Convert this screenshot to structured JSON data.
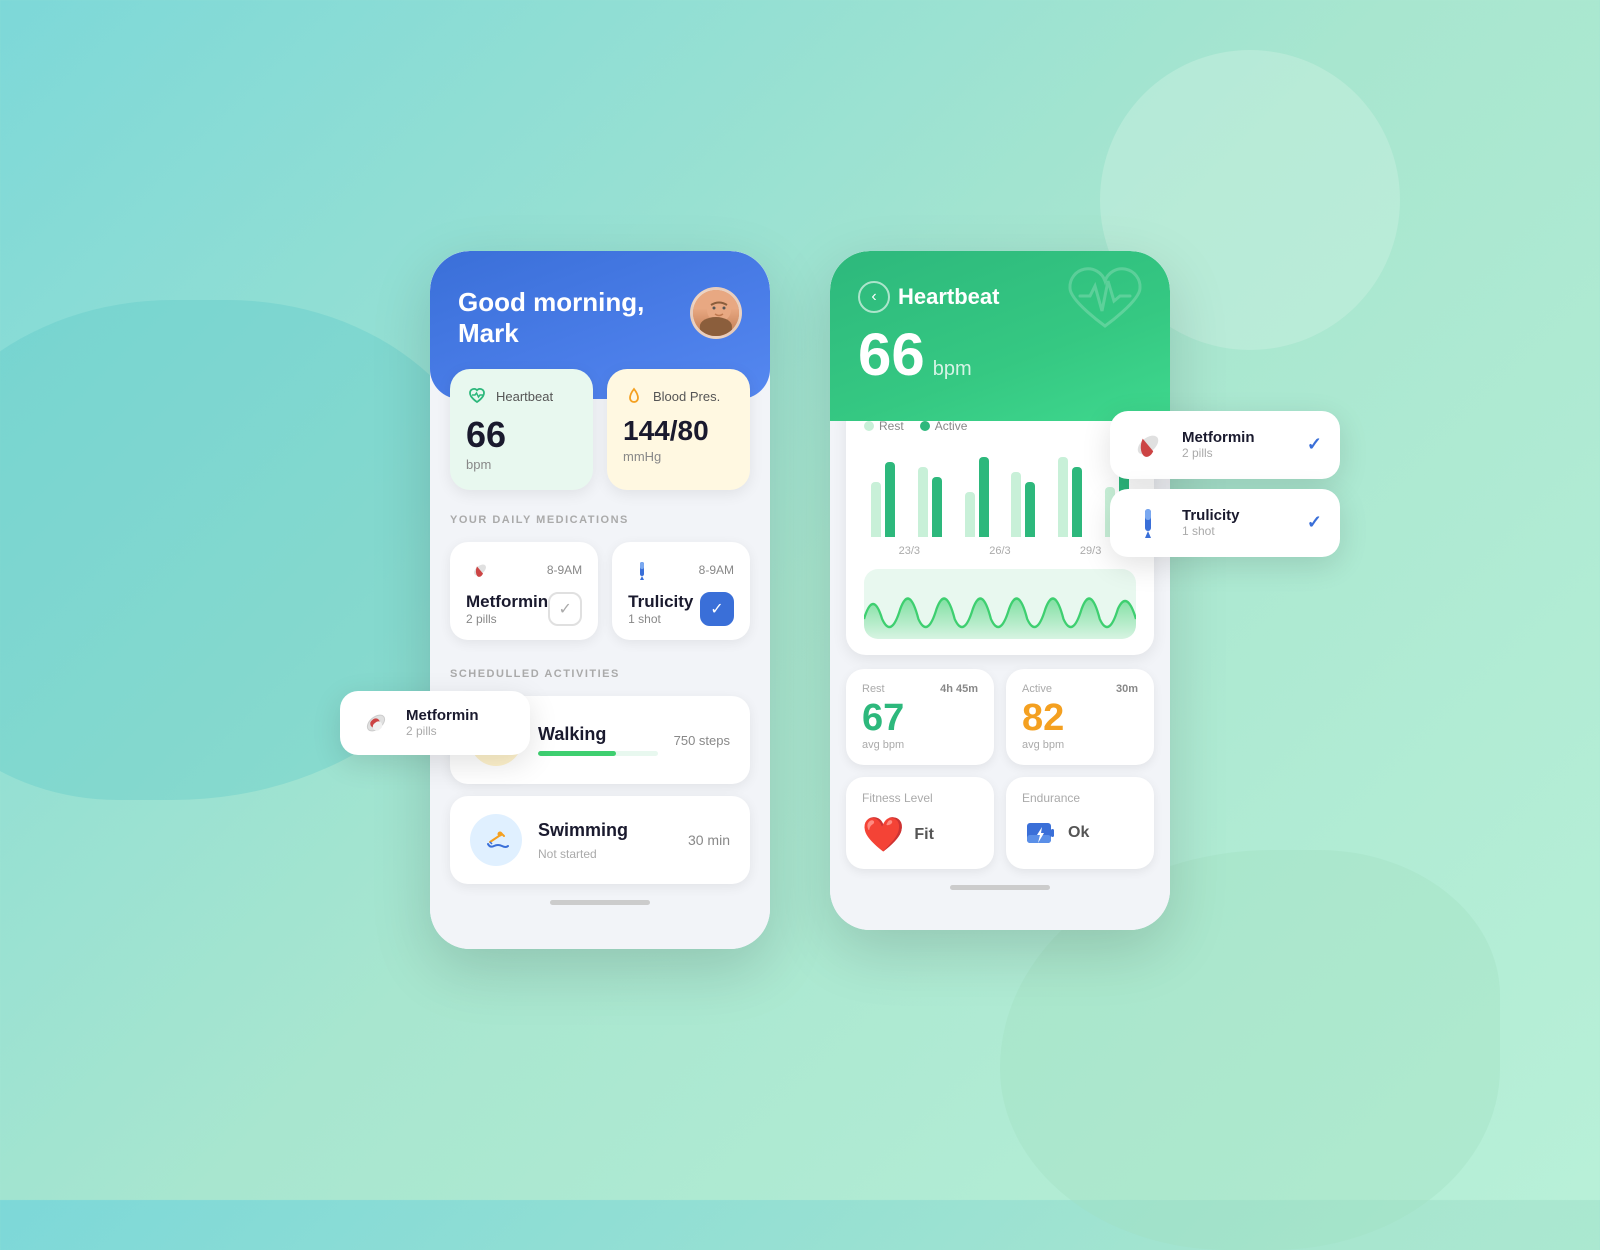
{
  "background": {
    "color1": "#7dd8d8",
    "color2": "#a8e6cf"
  },
  "leftPhone": {
    "greeting": "Good morning,\nMark",
    "greeting_line1": "Good morning,",
    "greeting_line2": "Mark",
    "metrics": [
      {
        "id": "heartbeat",
        "label": "Heartbeat",
        "value": "66",
        "unit": "bpm",
        "icon": "heart-icon",
        "cardType": "green"
      },
      {
        "id": "blood-pressure",
        "label": "Blood Pres.",
        "value": "144/80",
        "unit": "mmHg",
        "icon": "drop-icon",
        "cardType": "yellow"
      }
    ],
    "sectionMedications": "YOUR DAILY MEDICATIONS",
    "medications": [
      {
        "id": "metformin",
        "name": "Metformin",
        "dose": "2 pills",
        "time": "8-9AM",
        "checked": false,
        "icon": "pill-icon"
      },
      {
        "id": "trulicity",
        "name": "Trulicity",
        "dose": "1 shot",
        "time": "8-9AM",
        "checked": true,
        "icon": "syringe-icon"
      }
    ],
    "sectionActivities": "SCHEDULLED ACTIVITIES",
    "activities": [
      {
        "id": "walking",
        "name": "Walking",
        "steps": "750 steps",
        "progress": 65,
        "icon": "walking-icon",
        "iconBg": "yellow"
      },
      {
        "id": "swimming",
        "name": "Swimming",
        "duration": "30 min",
        "status": "Not started",
        "icon": "swimming-icon",
        "iconBg": "blue"
      }
    ],
    "floatingMed": {
      "name": "Metformin",
      "dose": "2 pills",
      "icon": "pill-icon"
    }
  },
  "rightPhone": {
    "backLabel": "back",
    "title": "Heartbeat",
    "bpm": "66",
    "bpmUnit": "bpm",
    "chartLegend": [
      {
        "label": "Rest",
        "color": "#c8f0d8"
      },
      {
        "label": "Active",
        "color": "#2db87c"
      }
    ],
    "barData": [
      {
        "date": "23/3",
        "rest": 55,
        "active": 75
      },
      {
        "date": "23/3",
        "rest": 70,
        "active": 60
      },
      {
        "date": "26/3",
        "rest": 45,
        "active": 80
      },
      {
        "date": "26/3",
        "rest": 65,
        "active": 55
      },
      {
        "date": "29/3",
        "rest": 80,
        "active": 70
      },
      {
        "date": "29/3",
        "rest": 50,
        "active": 85
      }
    ],
    "barDates": [
      "23/3",
      "26/3",
      "29/3"
    ],
    "stats": [
      {
        "id": "rest-stat",
        "mode": "Rest",
        "time": "4h 45m",
        "bpm": "67",
        "avgLabel": "avg bpm",
        "bpmColor": "green"
      },
      {
        "id": "active-stat",
        "mode": "Active",
        "time": "30m",
        "bpm": "82",
        "avgLabel": "avg bpm",
        "bpmColor": "orange"
      }
    ],
    "fitnessCards": [
      {
        "id": "fitness-level",
        "label": "Fitness Level",
        "icon": "heart-fitness-icon",
        "value": "Fit",
        "iconColor": "#e84040"
      },
      {
        "id": "endurance",
        "label": "Endurance",
        "icon": "battery-icon",
        "value": "Ok",
        "iconColor": "#3a6fd8"
      }
    ],
    "floatingMeds": [
      {
        "id": "metformin-right",
        "name": "Metformin",
        "dose": "2 pills",
        "icon": "capsule-icon",
        "checked": true
      },
      {
        "id": "trulicity-right",
        "name": "Trulicity",
        "dose": "1 shot",
        "icon": "pen-icon",
        "checked": true
      }
    ]
  }
}
